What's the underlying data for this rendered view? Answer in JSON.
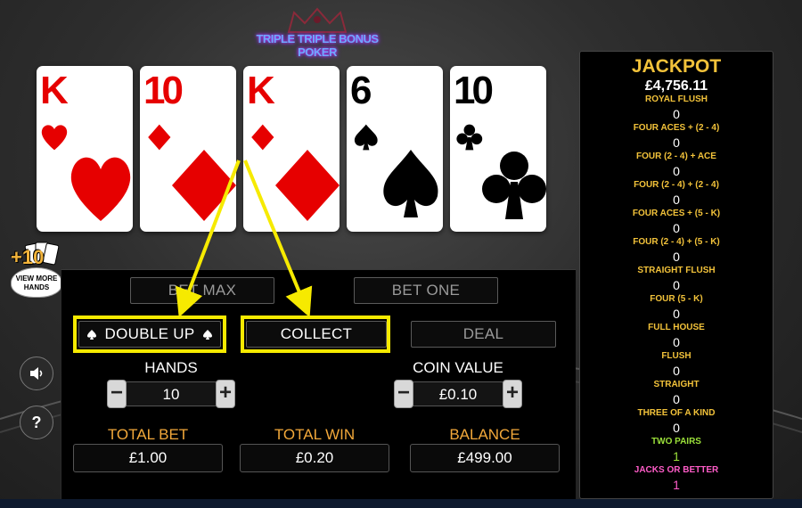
{
  "title": "TRIPLE TRIPLE BONUS POKER",
  "cards": [
    {
      "rank": "K",
      "suit": "hearts",
      "color": "red"
    },
    {
      "rank": "10",
      "suit": "diamonds",
      "color": "red"
    },
    {
      "rank": "K",
      "suit": "diamonds",
      "color": "red"
    },
    {
      "rank": "6",
      "suit": "spades",
      "color": "black"
    },
    {
      "rank": "10",
      "suit": "clubs",
      "color": "black"
    }
  ],
  "view_more": {
    "count": "+10",
    "line1": "VIEW MORE",
    "line2": "HANDS"
  },
  "buttons": {
    "bet_max": "BET MAX",
    "bet_one": "BET ONE",
    "double_up": "DOUBLE UP",
    "collect": "COLLECT",
    "deal": "DEAL"
  },
  "hands": {
    "label": "HANDS",
    "value": "10"
  },
  "coin_value": {
    "label": "COIN VALUE",
    "value": "£0.10"
  },
  "totals": {
    "total_bet_label": "TOTAL BET",
    "total_bet": "£1.00",
    "total_win_label": "TOTAL WIN",
    "total_win": "£0.20",
    "balance_label": "BALANCE",
    "balance": "£499.00"
  },
  "side": {
    "help": "?"
  },
  "jackpot": {
    "title": "JACKPOT",
    "amount": "£4,756.11",
    "paytable": [
      {
        "name": "ROYAL FLUSH",
        "value": "0",
        "color": "#f2c23a"
      },
      {
        "name": "FOUR ACES + (2 - 4)",
        "value": "0",
        "color": "#f2c23a"
      },
      {
        "name": "FOUR (2 - 4) + ACE",
        "value": "0",
        "color": "#f2c23a"
      },
      {
        "name": "FOUR (2 - 4) + (2 - 4)",
        "value": "0",
        "color": "#f2c23a"
      },
      {
        "name": "FOUR ACES + (5 - K)",
        "value": "0",
        "color": "#f2c23a"
      },
      {
        "name": "FOUR (2 - 4) + (5 - K)",
        "value": "0",
        "color": "#f2c23a"
      },
      {
        "name": "STRAIGHT FLUSH",
        "value": "0",
        "color": "#f2c23a"
      },
      {
        "name": "FOUR (5 - K)",
        "value": "0",
        "color": "#f2c23a"
      },
      {
        "name": "FULL HOUSE",
        "value": "0",
        "color": "#f2c23a"
      },
      {
        "name": "FLUSH",
        "value": "0",
        "color": "#f2c23a"
      },
      {
        "name": "STRAIGHT",
        "value": "0",
        "color": "#f2c23a"
      },
      {
        "name": "THREE OF A KIND",
        "value": "0",
        "color": "#f2c23a"
      },
      {
        "name": "TWO PAIRS",
        "value": "1",
        "color": "#9be03a"
      },
      {
        "name": "JACKS OR BETTER",
        "value": "1",
        "color": "#ff5cc8"
      }
    ]
  },
  "colors": {
    "accent": "#f2a83a",
    "highlight": "#f6ea00",
    "gold": "#f2c23a"
  }
}
